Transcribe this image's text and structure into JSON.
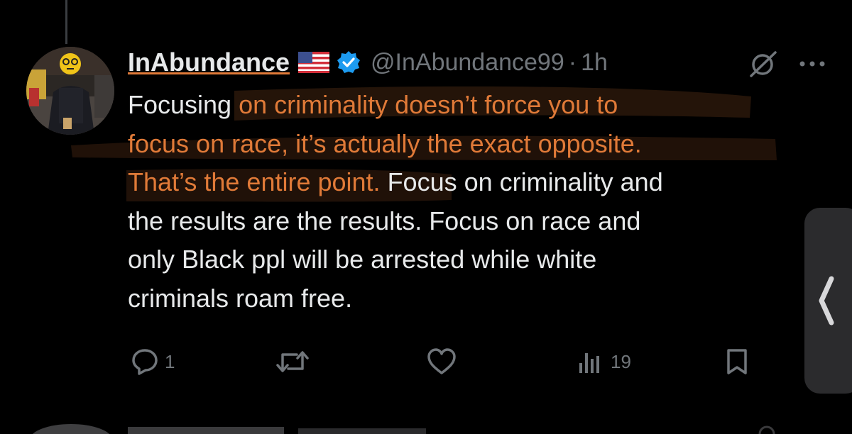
{
  "tweet": {
    "display_name": "InAbundance",
    "flag_icon": "us-flag-icon",
    "verified_icon": "verified-badge-icon",
    "handle": "@InAbundance99",
    "separator": "·",
    "time": "1h",
    "text_highlight_1": "on criminality doesn’t force you to",
    "text_prefix": "Focusing ",
    "text_highlight_2": "focus on race, it’s actually the exact opposite.",
    "text_highlight_3": "That’s the entire point.",
    "text_rest_1": " Focus on criminality and",
    "text_rest_2": "the results are the results. Focus on race and",
    "text_rest_3": "only Black ppl will be arrested while white",
    "text_rest_4": "criminals roam free.",
    "highlight_color": "#e07a38"
  },
  "actions": {
    "reply_count": "1",
    "repost_count": "",
    "like_count": "",
    "views_count": "19"
  },
  "icons": {
    "reply": "reply-icon",
    "repost": "repost-icon",
    "like": "heart-icon",
    "views": "views-chart-icon",
    "bookmark": "bookmark-icon",
    "grok": "grok-icon",
    "more": "more-dots-icon",
    "side": "chevron-left-icon"
  }
}
